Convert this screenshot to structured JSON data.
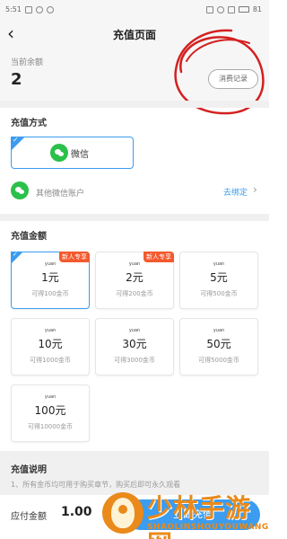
{
  "status_bar": {
    "time": "5:51",
    "battery": "81"
  },
  "nav": {
    "title": "充值页面"
  },
  "balance": {
    "label": "当前余额",
    "value": "2",
    "button": "消费记录"
  },
  "pay_method": {
    "title": "充值方式",
    "selected": {
      "label": "微信"
    },
    "other": {
      "label": "其他微信账户",
      "link": "去绑定"
    }
  },
  "amounts": {
    "title": "充值金额",
    "yuan_symbol": "yuan",
    "cards": [
      {
        "value": "1元",
        "sub": "可得100金币",
        "badge": "新人专享",
        "selected": true
      },
      {
        "value": "2元",
        "sub": "可得200金币",
        "badge": "新人专享",
        "selected": false
      },
      {
        "value": "5元",
        "sub": "可得500金币",
        "badge": "",
        "selected": false
      },
      {
        "value": "10元",
        "sub": "可得1000金币",
        "badge": "",
        "selected": false
      },
      {
        "value": "30元",
        "sub": "可得3000金币",
        "badge": "",
        "selected": false
      },
      {
        "value": "50元",
        "sub": "可得5000金币",
        "badge": "",
        "selected": false
      },
      {
        "value": "100元",
        "sub": "可得10000金币",
        "badge": "",
        "selected": false
      }
    ]
  },
  "description": {
    "title": "充值说明",
    "line1": "1、所有金币均可用于购买章节，购买后即可永久观看"
  },
  "footer": {
    "pay_label": "应付金额",
    "pay_value": "1.00",
    "pay_button": "立即充值"
  },
  "watermark": {
    "title": "少林手游网",
    "subtitle": "SHAOLINSHOUYOUWANG"
  },
  "colors": {
    "accent": "#3b9cf0",
    "badge": "#f35a2e",
    "wechat": "#2bc04a",
    "scribble": "#d42020"
  }
}
